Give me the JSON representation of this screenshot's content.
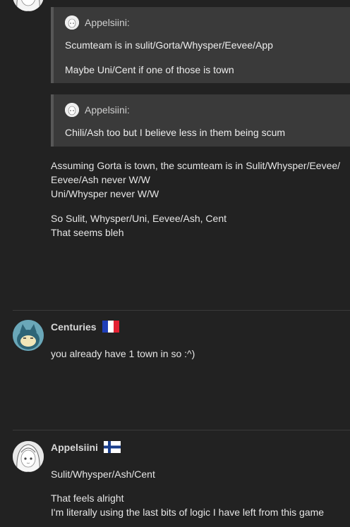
{
  "top_avatar": {
    "icon": "anime-girl-avatar-icon"
  },
  "quote1": {
    "author": "Appelsiini:",
    "lines": [
      "Scumteam is in sulit/Gorta/Whysper/Eevee/App",
      "Maybe Uni/Cent if one of those is town"
    ]
  },
  "quote2": {
    "author": "Appelsiini:",
    "lines": [
      "Chili/Ash too but I believe less in them being scum"
    ]
  },
  "post1": {
    "lines": [
      "Assuming Gorta is town, the scumteam is in Sulit/Whysper/Eevee/",
      "Eevee/Ash never W/W",
      "Uni/Whysper never W/W",
      "So Sulit, Whysper/Uni, Eevee/Ash, Cent",
      "That seems bleh"
    ]
  },
  "post2": {
    "author": "Centuries",
    "flag": "france-flag-icon",
    "lines": [
      "you already have 1 town in so :^)"
    ]
  },
  "post3": {
    "author": "Appelsiini",
    "flag": "finland-flag-icon",
    "lines": [
      "Sulit/Whysper/Ash/Cent",
      "That feels alright",
      "I'm literally using the last bits of logic I have left from this game"
    ]
  }
}
